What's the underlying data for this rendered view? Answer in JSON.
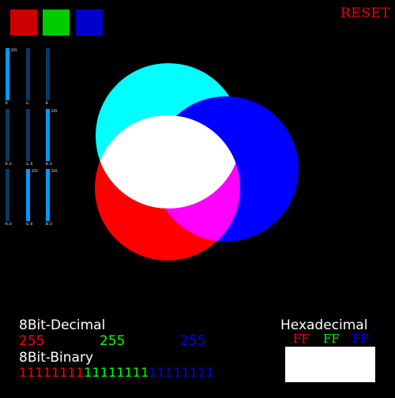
{
  "colors": {
    "red": "#ff0000",
    "green": "#00ff00",
    "blue": "#0000ff",
    "swatch_red": "#cc0000",
    "swatch_green": "#00cc00",
    "swatch_blue": "#0000cc",
    "slider_track": "#073a63",
    "slider_fill": "#0099ff",
    "cyan": "#00ffff",
    "magenta": "#ff00ff",
    "white": "#ffffff",
    "background": "#000000"
  },
  "header": {
    "reset_label": "RESET"
  },
  "sliders": {
    "rows": [
      [
        {
          "label": "255",
          "level": 1.0
        },
        {
          "label": "",
          "level": 0.0
        },
        {
          "label": "",
          "level": 0.0
        }
      ],
      [
        {
          "label": "",
          "level": 0.0
        },
        {
          "label": "",
          "level": 0.0
        },
        {
          "label": "255",
          "level": 1.0
        }
      ],
      [
        {
          "label": "",
          "level": 0.0
        },
        {
          "label": "255",
          "level": 1.0
        },
        {
          "label": "255",
          "level": 1.0
        }
      ]
    ],
    "bottom_labels": [
      [
        "R",
        "G",
        "B"
      ],
      [
        "R..0",
        "G..0",
        "B..0"
      ],
      [
        "R..0",
        "G..0",
        "B..0"
      ]
    ]
  },
  "venn": {
    "circles": [
      "cyan",
      "blue",
      "red"
    ],
    "overlap_colors": [
      "white",
      "magenta"
    ]
  },
  "decimal": {
    "title": "8Bit-Decimal",
    "red": "255",
    "green": "255",
    "blue": "255"
  },
  "binary": {
    "title": "8Bit-Binary",
    "red": "11111111",
    "green": "11111111",
    "blue": "11111111"
  },
  "hex": {
    "title": "Hexadecimal",
    "red": "FF",
    "green": "FF",
    "blue": "FF",
    "preview_color": "#ffffff"
  }
}
